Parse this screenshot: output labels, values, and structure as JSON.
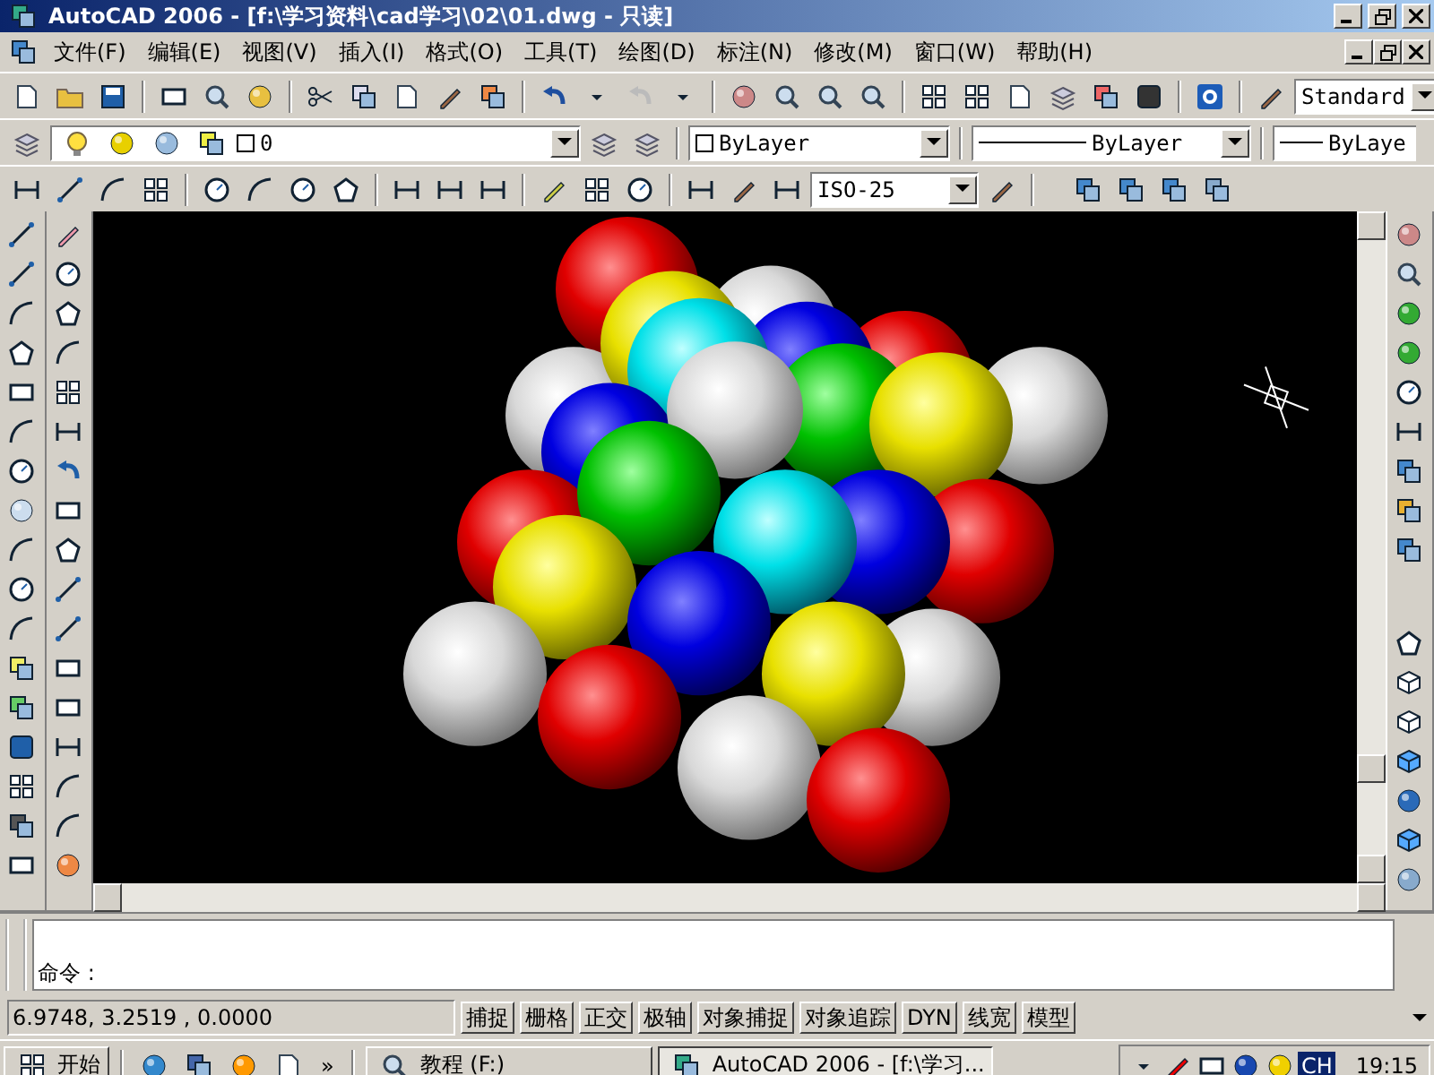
{
  "window": {
    "title": "AutoCAD 2006 - [f:\\学习资料\\cad学习\\02\\01.dwg - 只读]"
  },
  "menu": [
    "文件(F)",
    "编辑(E)",
    "视图(V)",
    "插入(I)",
    "格式(O)",
    "工具(T)",
    "绘图(D)",
    "标注(N)",
    "修改(M)",
    "窗口(W)",
    "帮助(H)"
  ],
  "toolbars": {
    "text_style": "Standard",
    "layer": "0",
    "color_control": "ByLayer",
    "linetype": "ByLayer",
    "lineweight": "ByLaye",
    "dimension_style": "ISO-25"
  },
  "command_line": {
    "prompt": "命令 :"
  },
  "status_bar": {
    "coordinates": "6.9748, 3.2519 , 0.0000",
    "toggles": [
      "捕捉",
      "栅格",
      "正交",
      "极轴",
      "对象捕捉",
      "对象追踪",
      "DYN",
      "线宽",
      "模型"
    ]
  },
  "taskbar": {
    "start": "开始",
    "more": "»",
    "tasks": [
      {
        "label": "教程 (F:)",
        "selected": false
      },
      {
        "label": "AutoCAD 2006 - [f:\\学习...",
        "selected": true
      }
    ],
    "language": "CH",
    "clock": "19:15"
  }
}
